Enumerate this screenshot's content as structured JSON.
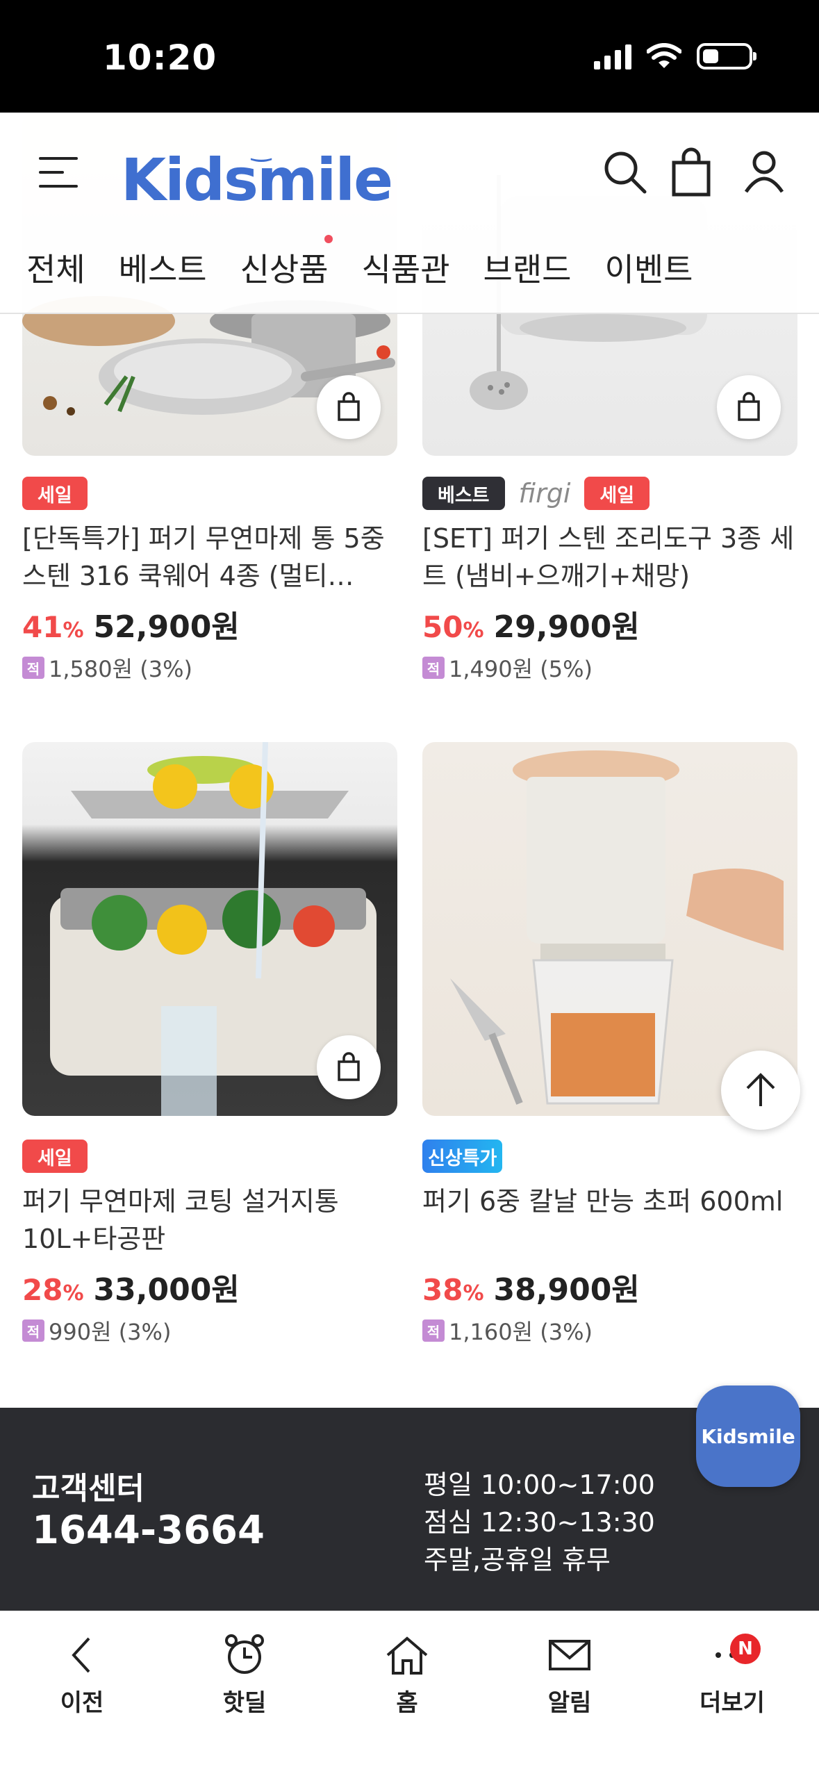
{
  "status": {
    "time": "10:20"
  },
  "header": {
    "logo": "Kidsmile",
    "nav": [
      "전체",
      "베스트",
      "신상품",
      "식품관",
      "브랜드",
      "이벤트"
    ]
  },
  "products": [
    {
      "badges": [
        "세일"
      ],
      "title": "[단독특가] 퍼기 무연마제 통 5중 스텐 316 쿡웨어 4종 (멀티…",
      "rate": "41",
      "rate_unit": "%",
      "price": "52,900원",
      "point": "1,580원 (3%)"
    },
    {
      "badges": [
        "베스트",
        "firgi",
        "세일"
      ],
      "title": "[SET] 퍼기 스텐 조리도구 3종 세트 (냄비+으깨기+채망)",
      "rate": "50",
      "rate_unit": "%",
      "price": "29,900원",
      "point": "1,490원 (5%)"
    },
    {
      "badges": [
        "세일"
      ],
      "title": "퍼기 무연마제 코팅 설거지통 10L+타공판",
      "rate": "28",
      "rate_unit": "%",
      "price": "33,000원",
      "point": "990원 (3%)"
    },
    {
      "badges": [
        "신상특가"
      ],
      "title": "퍼기 6중 칼날 만능 초퍼 600ml",
      "rate": "38",
      "rate_unit": "%",
      "price": "38,900원",
      "point": "1,160원 (3%)"
    }
  ],
  "point_icon_label": "적",
  "floating": {
    "label": "Kidsmile"
  },
  "footer": {
    "cs_label": "고객센터",
    "phone": "1644-3664",
    "hours": [
      "평일 10:00~17:00",
      "점심 12:30~13:30",
      "주말,공휴일 휴무"
    ]
  },
  "tabbar": {
    "items": [
      "이전",
      "핫딜",
      "홈",
      "알림",
      "더보기"
    ],
    "badge": "N"
  }
}
